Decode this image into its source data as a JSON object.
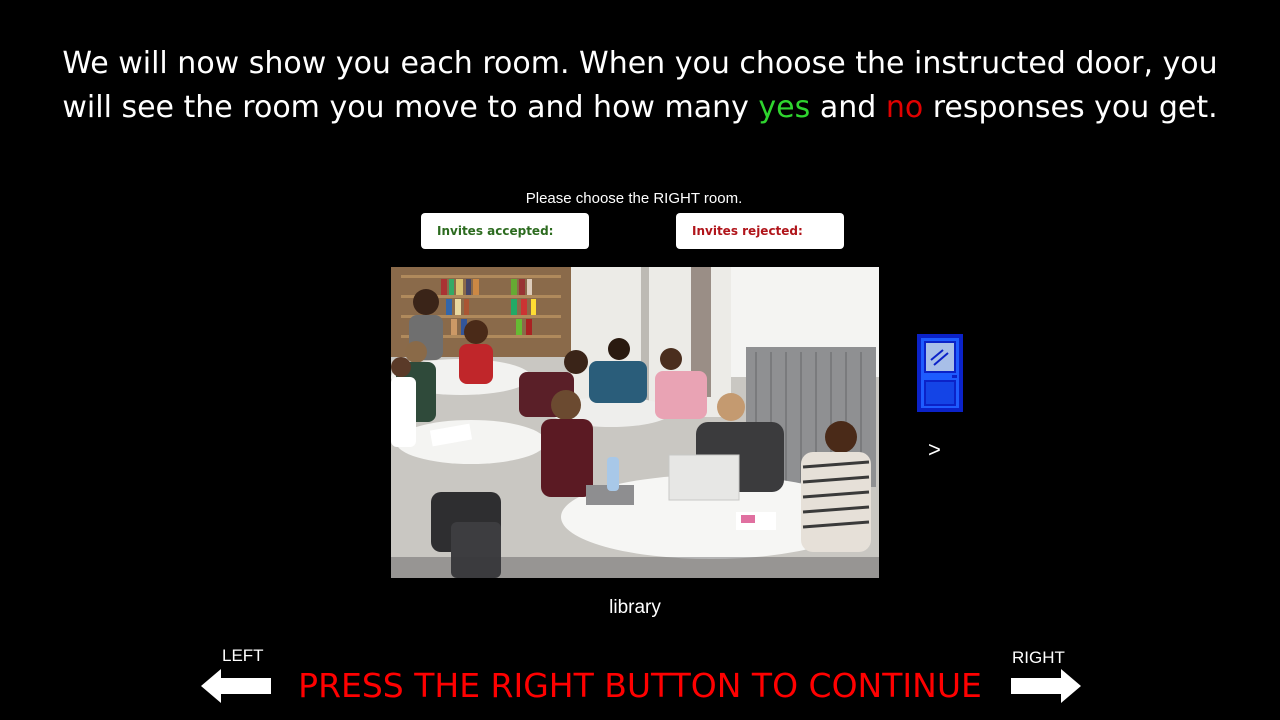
{
  "instructions": {
    "line1": "We will now show you each room. When you choose the instructed door, you",
    "line2_before": "will see the room you move to and how many",
    "yes_word": "yes",
    "middle_word": "and",
    "no_word": "no",
    "line2_after": "responses you get."
  },
  "task": {
    "prompt": "Please choose the RIGHT room.",
    "accepted_label": "Invites accepted:",
    "rejected_label": "Invites rejected:"
  },
  "room": {
    "image_subject": "students studying at round tables in a library",
    "caption": "library"
  },
  "door": {
    "icon": "door-icon",
    "color": "#1a4fe0",
    "key_hint": ">"
  },
  "navigation": {
    "left_label": "LEFT",
    "right_label": "RIGHT",
    "continue_text": "PRESS THE RIGHT BUTTON TO CONTINUE"
  },
  "colors": {
    "yes": "#2fd52f",
    "no": "#e00000",
    "accepted_text": "#2c6b1f",
    "rejected_text": "#b0141a",
    "continue": "#ff0000"
  }
}
